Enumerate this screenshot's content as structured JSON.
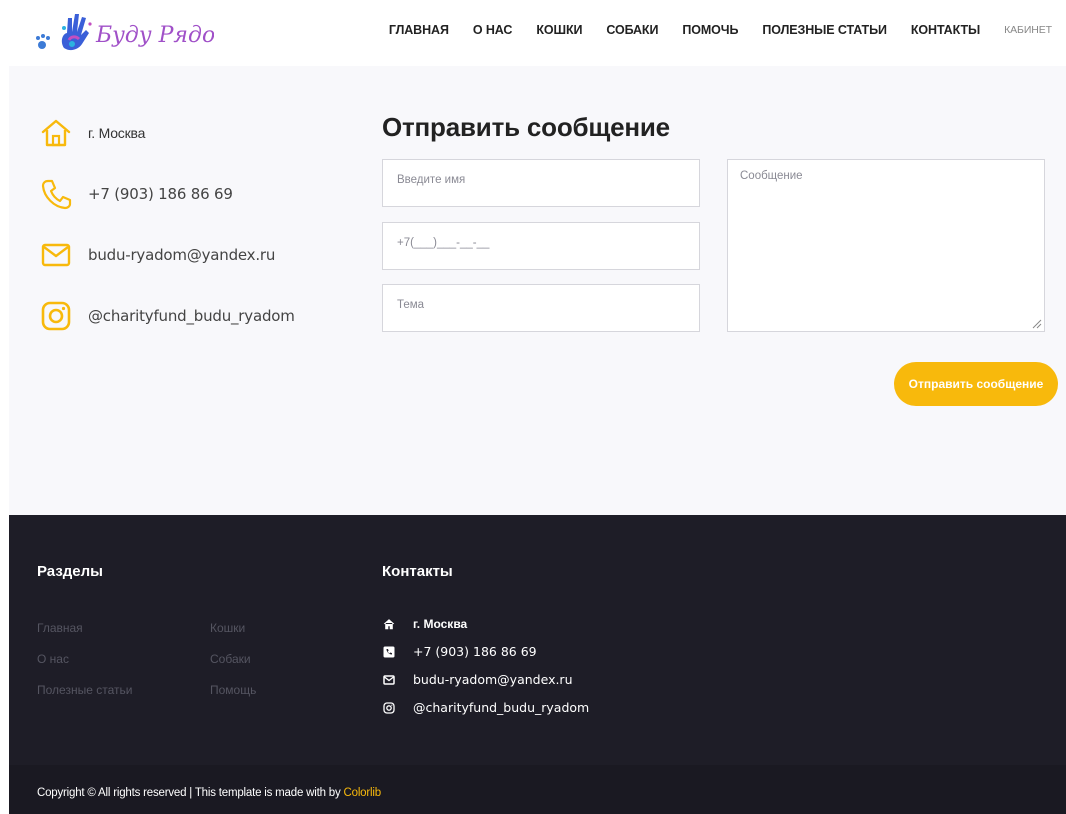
{
  "brand": {
    "logo_text": "Буду Рядом"
  },
  "nav": {
    "items": [
      "ГЛАВНАЯ",
      "О НАС",
      "КОШКИ",
      "СОБАКИ",
      "ПОМОЧЬ",
      "ПОЛЕЗНЫЕ СТАТЬИ",
      "КОНТАКТЫ"
    ],
    "cabinet": "КАБИНЕТ"
  },
  "contacts": {
    "city": "г. Москва",
    "phone": "+7 (903) 186 86 69",
    "email": "budu-ryadom@yandex.ru",
    "instagram": "@charityfund_budu_ryadom"
  },
  "form": {
    "title": "Отправить сообщение",
    "name_placeholder": "Введите имя",
    "phone_placeholder": "+7(___)___-__-__",
    "subject_placeholder": "Тема",
    "message_placeholder": "Сообщение",
    "submit_label": "Отправить сообщение"
  },
  "footer": {
    "sections_title": "Разделы",
    "links_col1": [
      "Главная",
      "О нас",
      "Полезные статьи"
    ],
    "links_col2": [
      "Кошки",
      "Собаки",
      "Помощь"
    ],
    "contacts_title": "Контакты",
    "contacts": {
      "city": "г. Москва",
      "phone": "+7 (903) 186 86 69",
      "email": "budu-ryadom@yandex.ru",
      "instagram": "@charityfund_budu_ryadom"
    },
    "copyright_text": "Copyright © All rights reserved | This template is made with by ",
    "copyright_link": "Colorlib"
  },
  "colors": {
    "accent": "#f8b90c",
    "footer_bg": "#1e1d27",
    "content_bg": "#f8f8fb"
  },
  "icons": [
    "home-icon",
    "phone-icon",
    "mail-icon",
    "instagram-icon"
  ]
}
